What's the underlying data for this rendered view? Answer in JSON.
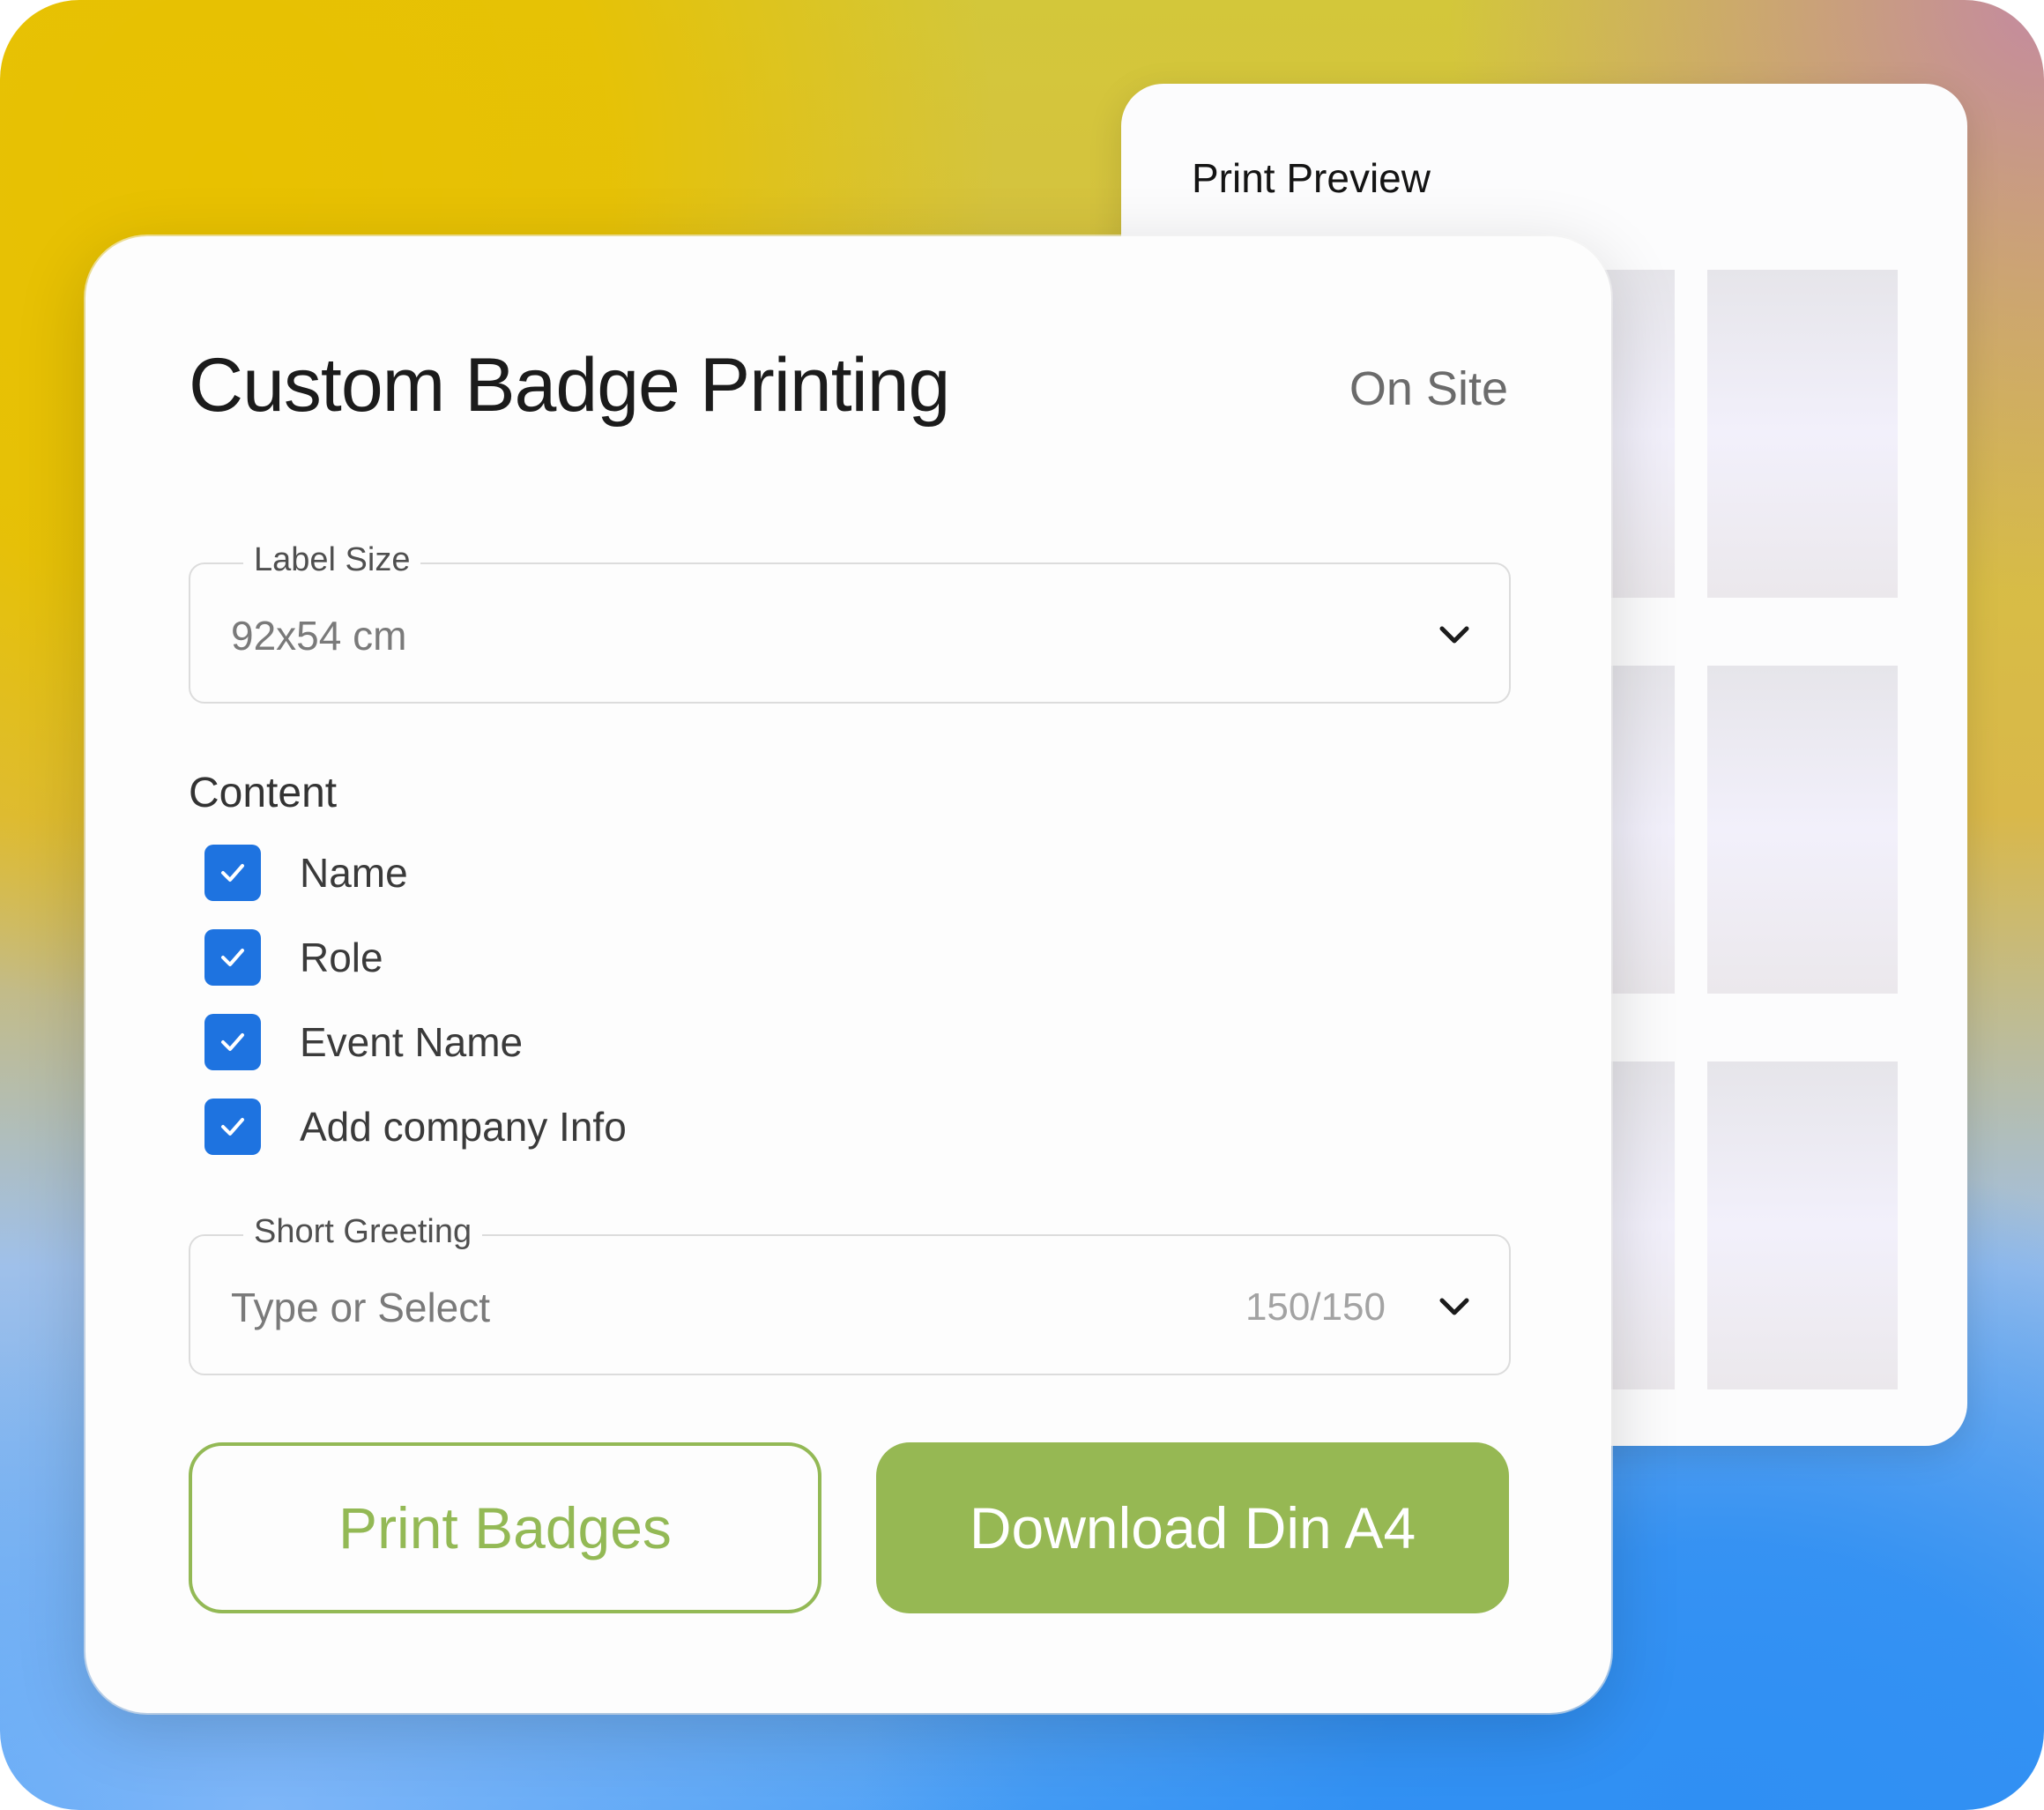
{
  "preview": {
    "title": "Print Preview"
  },
  "form": {
    "title": "Custom Badge Printing",
    "status": "On Site",
    "label_size": {
      "label": "Label Size",
      "value": "92x54 cm"
    },
    "content": {
      "title": "Content",
      "options": [
        {
          "label": "Name",
          "checked": true
        },
        {
          "label": "Role",
          "checked": true
        },
        {
          "label": "Event Name",
          "checked": true
        },
        {
          "label": "Add company Info",
          "checked": true
        }
      ]
    },
    "greeting": {
      "label": "Short Greeting",
      "placeholder": "Type or Select",
      "counter": "150/150"
    },
    "buttons": {
      "print": "Print Badges",
      "download": "Download Din A4"
    }
  },
  "colors": {
    "accent_green": "#96b853",
    "checkbox_blue": "#1e73e0"
  },
  "icons": {
    "dropdown": "chevron-down-icon",
    "check": "checkmark-icon"
  }
}
